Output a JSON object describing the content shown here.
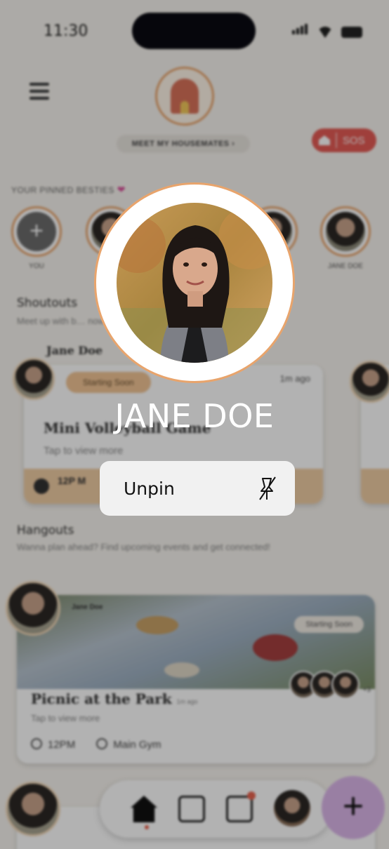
{
  "status_bar": {
    "time": "11:30"
  },
  "header": {
    "housemates_button": "MEET MY HOUSEMATES ›",
    "sos_label": "SOS"
  },
  "pinned": {
    "heading": "YOUR PINNED BESTIES",
    "you_label": "YOU",
    "last_label": "JANE DOE"
  },
  "shoutouts": {
    "title": "Shoutouts",
    "subtitle": "Meet up with b… now!",
    "author": "Jane Doe",
    "card": {
      "badge": "Starting Soon",
      "ago": "1m ago",
      "title": "Mini Volleyball Game",
      "tap": "Tap to view more",
      "time": "12P M"
    }
  },
  "hangouts": {
    "title": "Hangouts",
    "subtitle": "Wanna plan ahead? Find upcoming events and get connected!",
    "card": {
      "author": "Jane Doe",
      "badge": "Starting Soon",
      "title": "Picnic at the Park",
      "ago": "1m ago",
      "tap": "Tap to view more",
      "time": "12PM",
      "location": "Main Gym",
      "extra_count": "+3"
    }
  },
  "popup": {
    "name": "JANE DOE",
    "unpin_label": "Unpin",
    "unpin_icon": "pin-off-icon"
  },
  "colors": {
    "accent_orange": "#e8a46c",
    "sos_red": "#e45b55",
    "fab_purple": "#dcb7ea",
    "badge_peach": "#f2c596"
  }
}
